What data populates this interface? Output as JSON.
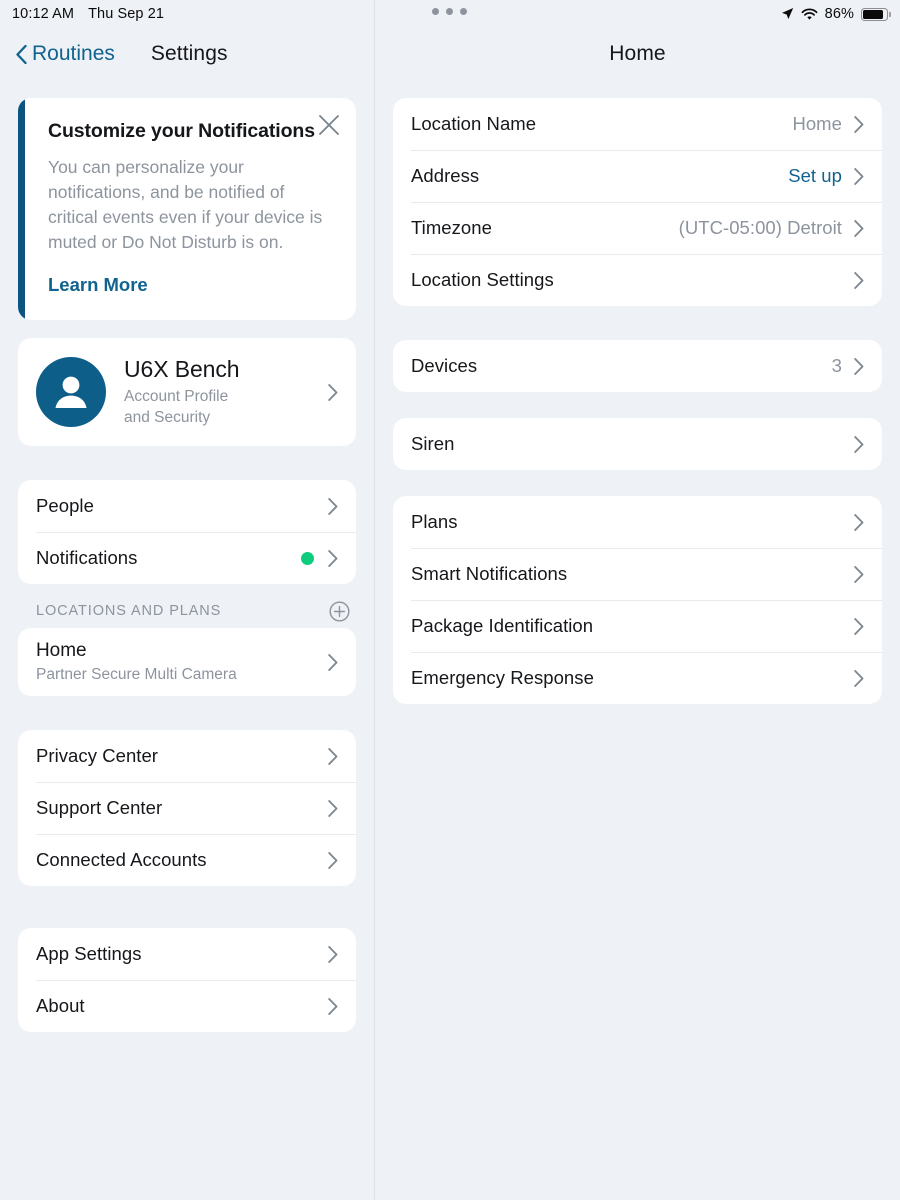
{
  "status_bar": {
    "time": "10:12 AM",
    "date": "Thu Sep 21",
    "battery_percent": "86%",
    "icons": [
      "location-arrow-icon",
      "wifi-icon",
      "battery-icon"
    ],
    "multitask_handle": "three-dots-handle"
  },
  "sidebar": {
    "back_label": "Routines",
    "title": "Settings",
    "banner": {
      "title": "Customize your Notifications",
      "body": "You can personalize your notifications, and be notified of critical events even if your device is muted or Do Not Disturb is on.",
      "link": "Learn More",
      "accent_color": "#0d5580",
      "close_icon": "close-icon"
    },
    "profile": {
      "name": "U6X Bench",
      "subtitle_line1": "Account Profile",
      "subtitle_line2": "and Security",
      "avatar_color": "#0e5e8a"
    },
    "group_people": [
      {
        "label": "People",
        "badge": false
      },
      {
        "label": "Notifications",
        "badge": true,
        "badge_color": "#0fcb7e"
      }
    ],
    "locations_header": {
      "label": "LOCATIONS AND PLANS",
      "add_icon": "plus-circle-icon"
    },
    "locations": [
      {
        "title": "Home",
        "subtitle": "Partner Secure Multi Camera"
      }
    ],
    "group_centers": [
      {
        "label": "Privacy Center"
      },
      {
        "label": "Support Center"
      },
      {
        "label": "Connected Accounts"
      }
    ],
    "group_app": [
      {
        "label": "App Settings"
      },
      {
        "label": "About"
      }
    ]
  },
  "detail": {
    "title": "Home",
    "group_location": [
      {
        "label": "Location Name",
        "value": "Home",
        "accent": false
      },
      {
        "label": "Address",
        "value": "Set up",
        "accent": true
      },
      {
        "label": "Timezone",
        "value": "(UTC-05:00) Detroit",
        "accent": false
      },
      {
        "label": "Location Settings",
        "value": "",
        "accent": false
      }
    ],
    "group_devices": [
      {
        "label": "Devices",
        "value": "3",
        "accent": false
      }
    ],
    "group_siren": [
      {
        "label": "Siren",
        "value": "",
        "accent": false
      }
    ],
    "group_services": [
      {
        "label": "Plans",
        "value": "",
        "accent": false
      },
      {
        "label": "Smart Notifications",
        "value": "",
        "accent": false
      },
      {
        "label": "Package Identification",
        "value": "",
        "accent": false
      },
      {
        "label": "Emergency Response",
        "value": "",
        "accent": false
      }
    ]
  },
  "colors": {
    "background": "#eef1f5",
    "card": "#ffffff",
    "accent_blue": "#11638f",
    "status_green": "#0fcb7e",
    "muted_text": "#8d949e"
  }
}
